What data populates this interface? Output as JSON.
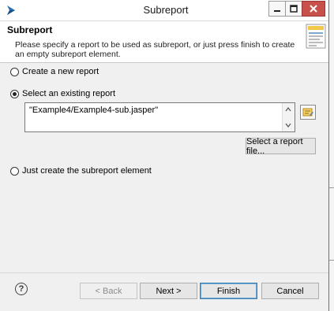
{
  "window": {
    "title": "Subreport",
    "icon": "eclipse-icon"
  },
  "header": {
    "title": "Subreport",
    "description": "Please specify a report to be used as subreport, or just press finish to create an empty subreport element.",
    "icon": "wizard-banner-icon"
  },
  "options": {
    "create_new": {
      "label": "Create a new report",
      "selected": false
    },
    "select_existing": {
      "label": "Select an existing report",
      "selected": true
    },
    "just_create": {
      "label": "Just create the subreport element",
      "selected": false
    }
  },
  "expression": {
    "value": "\"Example4/Example4-sub.jasper\""
  },
  "select_file_button": {
    "label": "Select a report file..."
  },
  "footer": {
    "back_label": "< Back",
    "next_label": "Next >",
    "finish_label": "Finish",
    "cancel_label": "Cancel",
    "help_glyph": "?"
  },
  "colors": {
    "close_button": "#c7504b",
    "dialog_background": "#f0f0f0",
    "default_button_border": "#3c7fb1"
  }
}
